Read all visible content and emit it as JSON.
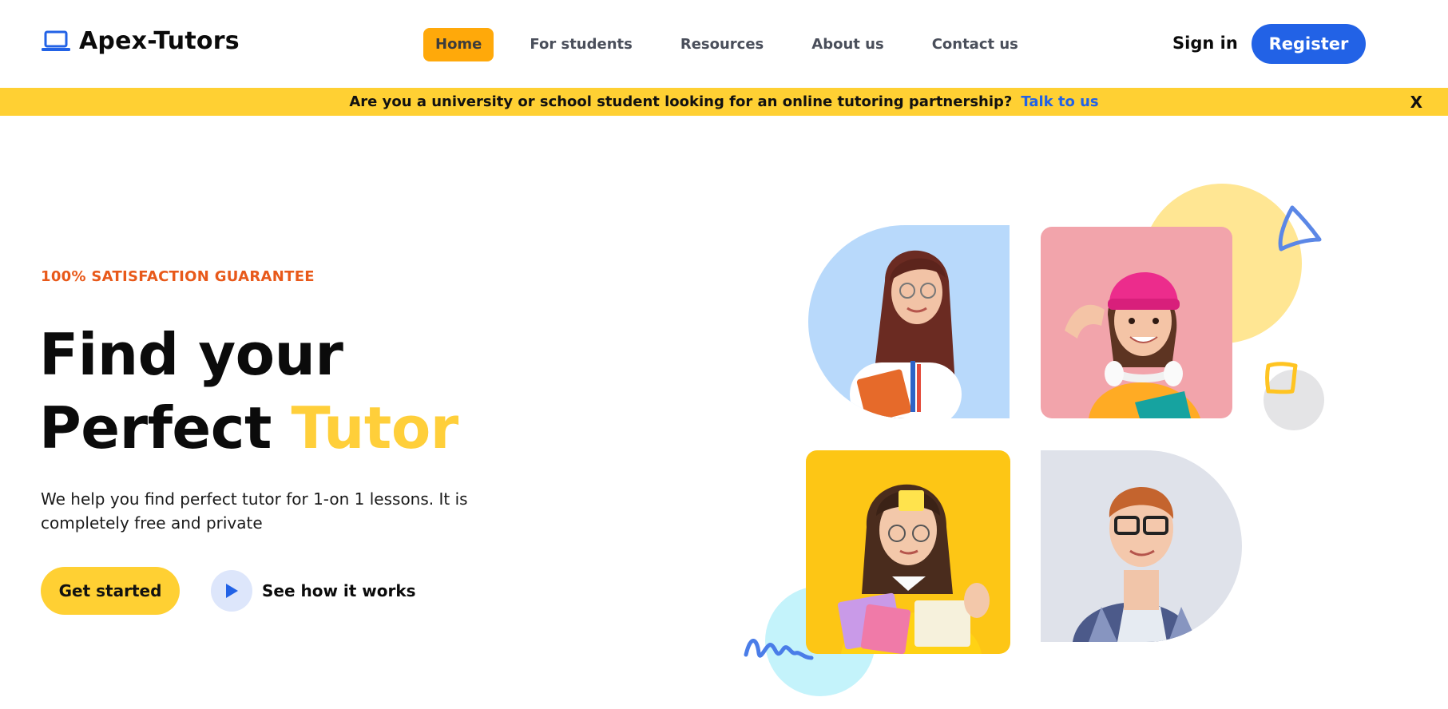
{
  "header": {
    "brand": "Apex-Tutors",
    "nav": [
      {
        "label": "Home",
        "active": true
      },
      {
        "label": "For students",
        "active": false
      },
      {
        "label": "Resources",
        "active": false
      },
      {
        "label": "About us",
        "active": false
      },
      {
        "label": "Contact us",
        "active": false
      }
    ],
    "sign_in": "Sign in",
    "register": "Register"
  },
  "banner": {
    "text": "Are you a university or school student looking for an online tutoring partnership?",
    "link": "Talk to us",
    "close": "X"
  },
  "hero": {
    "eyebrow": "100% SATISFACTION GUARANTEE",
    "headline_line1": "Find your",
    "headline_line2_plain": "Perfect",
    "headline_line2_accent": "Tutor",
    "subtext": "We help you find perfect tutor for 1-on 1 lessons. It is completely free and private",
    "primary_button": "Get started",
    "secondary_button": "See how it works"
  },
  "icons": {
    "logo": "laptop-icon",
    "play": "play-icon"
  },
  "colors": {
    "accent_blue": "#2262e6",
    "accent_yellow": "#ffd033",
    "nav_active": "#ffa90a",
    "eyebrow_orange": "#e8591a"
  }
}
